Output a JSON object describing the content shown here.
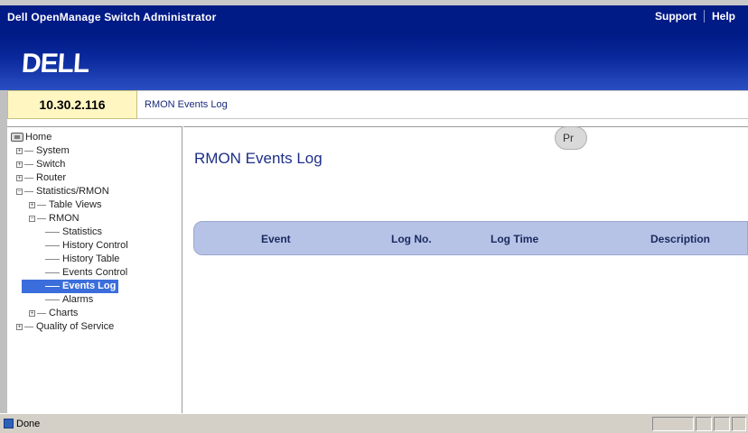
{
  "header": {
    "app_title": "Dell OpenManage Switch Administrator",
    "links": [
      "Support",
      "Help"
    ],
    "logo_text": "DELL"
  },
  "ip_address": "10.30.2.116",
  "breadcrumb": "RMON Events Log",
  "sidebar": {
    "home": "Home",
    "system": "System",
    "switch": "Switch",
    "router": "Router",
    "stats_rmon": "Statistics/RMON",
    "table_views": "Table Views",
    "rmon": "RMON",
    "statistics": "Statistics",
    "history_control": "History Control",
    "history_table": "History Table",
    "events_control": "Events Control",
    "events_log": "Events Log",
    "alarms": "Alarms",
    "charts": "Charts",
    "qos": "Quality of Service"
  },
  "main": {
    "title": "RMON Events Log",
    "print_label": "Pr",
    "table_headers": [
      "Event",
      "Log No.",
      "Log Time",
      "Description"
    ]
  },
  "status": {
    "text": "Done"
  }
}
